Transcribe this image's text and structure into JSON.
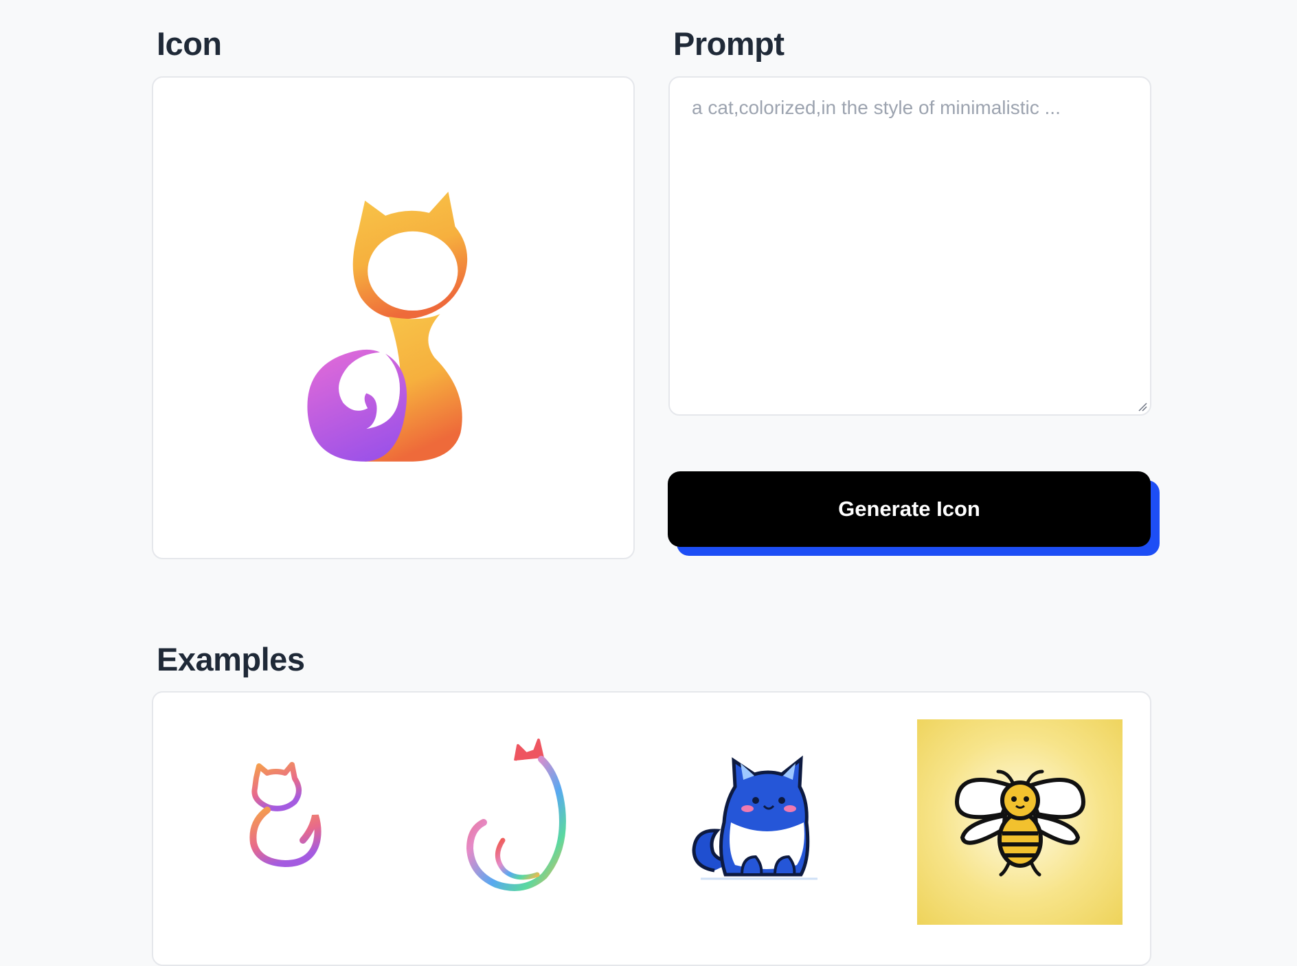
{
  "icon_section": {
    "heading": "Icon"
  },
  "prompt_section": {
    "heading": "Prompt",
    "value": "",
    "placeholder": "a cat,colorized,in the style of minimalistic ..."
  },
  "generate_button": {
    "label": "Generate Icon"
  },
  "examples_section": {
    "heading": "Examples",
    "items": [
      {
        "icon": "cat-outline-gradient-icon"
      },
      {
        "icon": "cat-rainbow-tail-icon"
      },
      {
        "icon": "blue-cat-cartoon-icon"
      },
      {
        "icon": "bee-cartoon-icon"
      }
    ]
  },
  "colors": {
    "background": "#f8f9fa",
    "button": "#000000",
    "button_shadow": "#1d4ef5",
    "border": "#e5e7eb"
  }
}
